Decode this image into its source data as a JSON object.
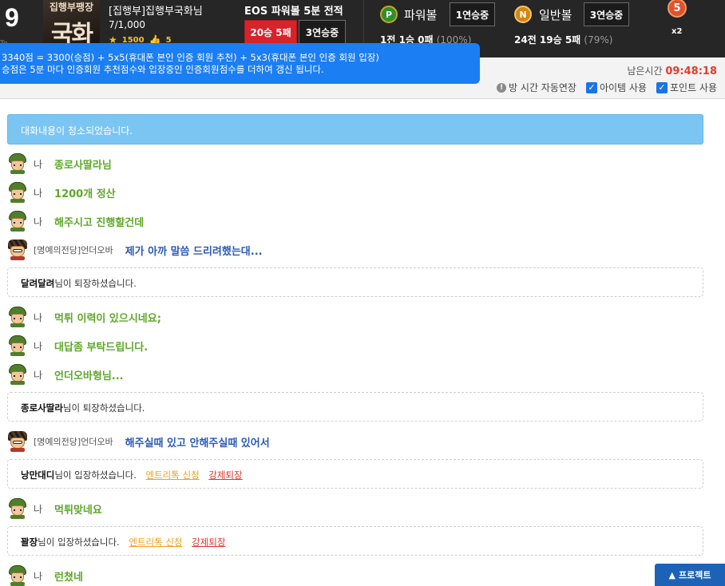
{
  "room": {
    "level": "9",
    "thumb_line1": "집행부팽장",
    "thumb_line2": "국화",
    "title": "[집행부]집행부국화님",
    "count": "7/1,000",
    "stat1": "1500",
    "stat2": "5",
    "side_fragment": "To"
  },
  "eos": {
    "title": "EOS 파워볼 5분 전적",
    "record_btn": "20승 5패",
    "streak_btn": "3연승중"
  },
  "powerball": {
    "ball": "P",
    "label": "파워볼",
    "streak": "1연승중",
    "record": "1전 1승 0패",
    "pct": "(100%)"
  },
  "normalball": {
    "ball": "N",
    "label": "일반볼",
    "streak": "3연승중",
    "record": "24전 19승 5패",
    "pct": "(79%)"
  },
  "medal": {
    "number": "5",
    "multiplier": "x2"
  },
  "tooltip": {
    "line1": "3340점 = 3300(승점) + 5x5(휴대폰 본인 인증 회원 추천) + 5x3(휴대폰 본인 인증 회원 입장)",
    "line2": "승점은 5분 마다 인증회원 추천점수와 입장중인 인증회원점수를 더하여 갱신 됩니다."
  },
  "timer": {
    "label": "남은시간",
    "time": "09:48:18"
  },
  "options": {
    "auto_extend": "방 시간 자동연장",
    "item_use": "아이템 사용",
    "point_use": "포인트 사용"
  },
  "chat": {
    "cleared": "대화내용이 청소되었습니다.",
    "me_label": "나",
    "rank_user": "[명예의전당]언더오바",
    "m1": "종로사딸라님",
    "m2": "1200개 정산",
    "m3": "해주시고 진행할건데",
    "m4": "제가 아까 말씀 드리려했는대...",
    "n1_user": "달려달려",
    "n1_text": "님이 퇴장하셨습니다.",
    "m5": "먹튀 이력이 있으시네요;",
    "m6": "대답좀 부탁드립니다.",
    "m7": "언더오바형님...",
    "n2_user": "종로사딸라",
    "n2_text": "님이 퇴장하셨습니다.",
    "m8": "해주실때 있고 안해주실때 있어서",
    "n3_user": "낭만대디",
    "n3_text": "님이 입장하셨습니다.",
    "link_entry": "엔트리톡 신청",
    "link_kick": "강제퇴장",
    "m9": "먹튀맞네요",
    "n4_user": "꽐장",
    "n4_text": "님이 입장하셨습니다.",
    "m10": "런쳤네"
  },
  "protect_label": "프로젝트",
  "colors": {
    "accent_blue": "#1c7ef3",
    "red": "#d6242a",
    "green_text": "#5ea82a",
    "blue_text": "#2b59b7",
    "timer_red": "#e43b2c"
  }
}
